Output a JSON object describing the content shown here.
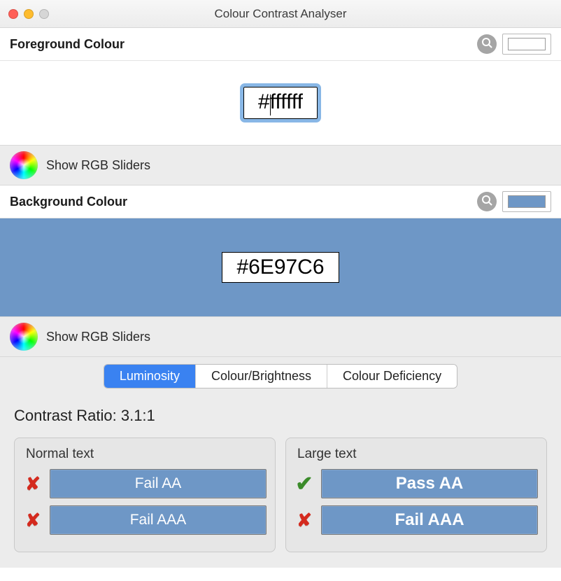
{
  "window": {
    "title": "Colour Contrast Analyser"
  },
  "foreground": {
    "label": "Foreground Colour",
    "hex": "#ffffff",
    "swatch": "#ffffff",
    "sliders_label": "Show RGB Sliders"
  },
  "background": {
    "label": "Background Colour",
    "hex": "#6E97C6",
    "swatch": "#6E97C6",
    "sliders_label": "Show RGB Sliders"
  },
  "tabs": {
    "luminosity": "Luminosity",
    "colour_brightness": "Colour/Brightness",
    "colour_deficiency": "Colour Deficiency",
    "active": "luminosity"
  },
  "results": {
    "ratio_label": "Contrast Ratio: 3.1:1",
    "normal": {
      "title": "Normal text",
      "aa": {
        "label": "Fail AA",
        "pass": false
      },
      "aaa": {
        "label": "Fail AAA",
        "pass": false
      }
    },
    "large": {
      "title": "Large text",
      "aa": {
        "label": "Pass AA",
        "pass": true
      },
      "aaa": {
        "label": "Fail AAA",
        "pass": false
      }
    }
  },
  "icons": {
    "fail": "✘",
    "pass": "✔"
  }
}
